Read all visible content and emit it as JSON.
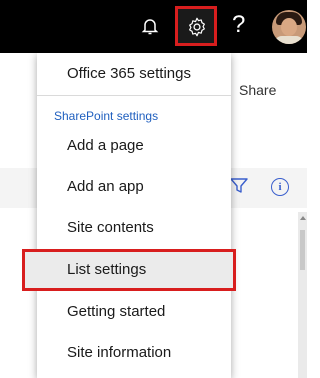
{
  "topbar": {
    "icons": [
      "bell-icon",
      "gear-icon",
      "help-icon",
      "avatar"
    ],
    "help_glyph": "?"
  },
  "page": {
    "share_label": "Share"
  },
  "settings_menu": {
    "top_item": "Office 365 settings",
    "section_title": "SharePoint settings",
    "items": [
      "Add a page",
      "Add an app",
      "Site contents",
      "List settings",
      "Getting started",
      "Site information"
    ],
    "highlighted_item": "List settings"
  },
  "colors": {
    "topbar": "#000000",
    "highlight_border": "#d81e1e",
    "section_title": "#1f5fbf",
    "hover_background": "#ebebeb"
  }
}
